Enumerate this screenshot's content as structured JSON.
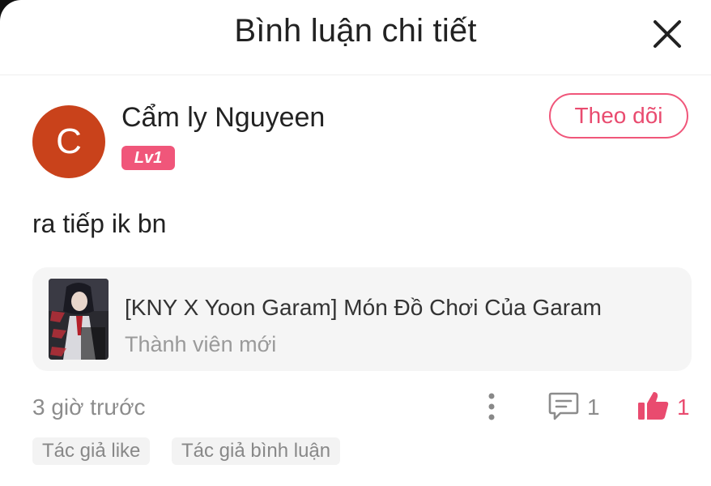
{
  "header": {
    "title": "Bình luận chi tiết",
    "close_icon": "close-icon"
  },
  "comment": {
    "author": {
      "avatar_letter": "C",
      "avatar_color": "#c9421b",
      "name": "Cẩm ly Nguyeen",
      "level": "Lv1"
    },
    "follow_label": "Theo dõi",
    "text": "ra tiếp ik bn",
    "story": {
      "title": "[KNY X Yoon Garam] Món Đồ Chơi Của Garam",
      "subtitle": "Thành viên mới"
    },
    "timestamp": "3 giờ trước",
    "reply_count": "1",
    "like_count": "1",
    "tags": [
      "Tác giả like",
      "Tác giả bình luận"
    ]
  },
  "colors": {
    "accent": "#e94b6f",
    "badge": "#f0567a",
    "card_bg": "#f5f5f5"
  }
}
